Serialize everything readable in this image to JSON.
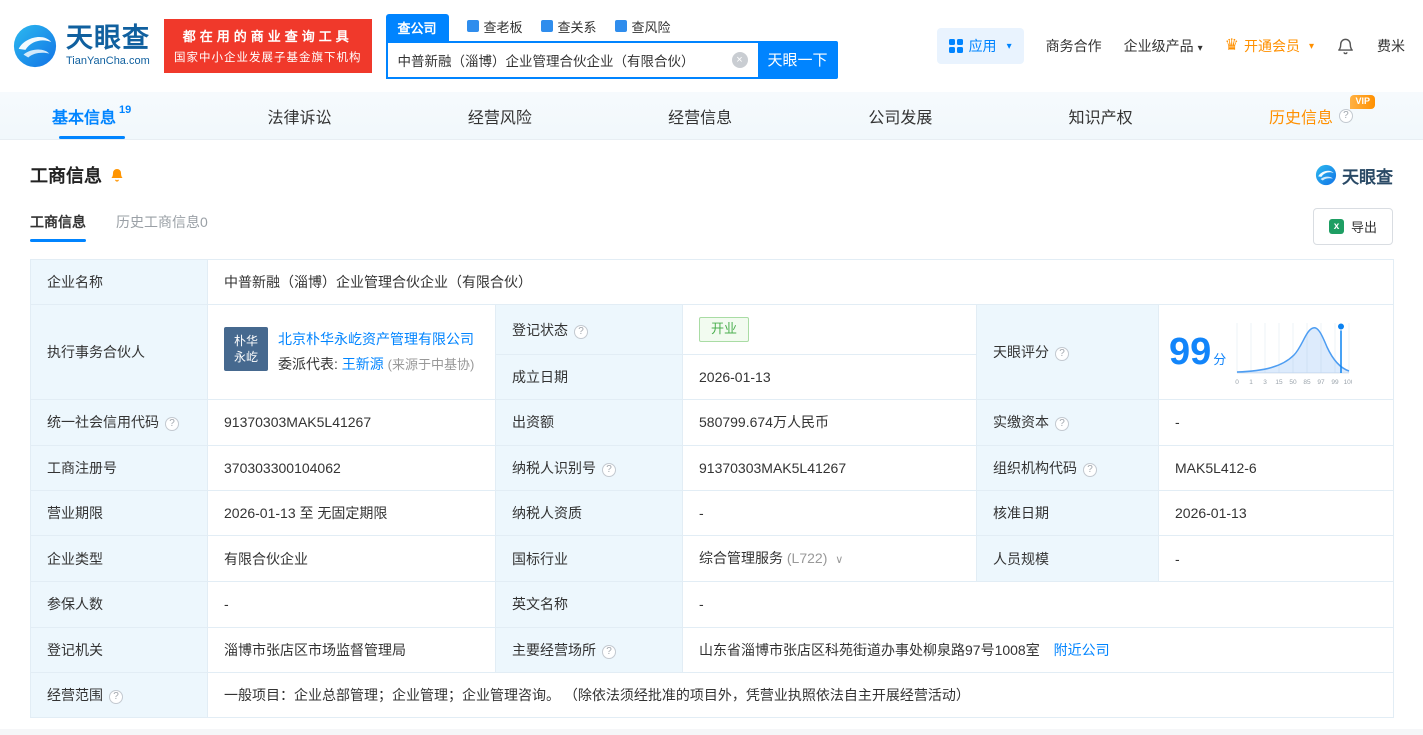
{
  "topbar": {
    "logo": {
      "title": "天眼查",
      "subtitle": "TianYanCha.com"
    },
    "slogan": {
      "line1": "都在用的商业查询工具",
      "line2": "国家中小企业发展子基金旗下机构"
    },
    "search": {
      "tabs": [
        {
          "label": "查公司",
          "active": true
        },
        {
          "label": "查老板"
        },
        {
          "label": "查关系"
        },
        {
          "label": "查风险"
        }
      ],
      "value": "中普新融（淄博）企业管理合伙企业（有限合伙）",
      "button": "天眼一下"
    },
    "right": {
      "apps": "应用",
      "cooperation": "商务合作",
      "enterprise": "企业级产品",
      "vip": "开通会员",
      "user": "费米"
    }
  },
  "nav": {
    "tabs": [
      {
        "label": "基本信息",
        "count": "19",
        "active": true
      },
      {
        "label": "法律诉讼"
      },
      {
        "label": "经营风险"
      },
      {
        "label": "经营信息"
      },
      {
        "label": "公司发展"
      },
      {
        "label": "知识产权"
      },
      {
        "label": "历史信息",
        "vip": "VIP"
      }
    ]
  },
  "section": {
    "title": "工商信息",
    "brand": "天眼查",
    "subtabs": [
      {
        "label": "工商信息",
        "active": true
      },
      {
        "label": "历史工商信息0"
      }
    ],
    "export": "导出"
  },
  "table": {
    "company_name": {
      "label": "企业名称",
      "value": "中普新融（淄博）企业管理合伙企业（有限合伙）"
    },
    "executive_partner": {
      "label": "执行事务合伙人",
      "avatar_line1": "朴华",
      "avatar_line2": "永屹",
      "company": "北京朴华永屹资产管理有限公司",
      "delegate_label": "委派代表: ",
      "delegate": "王新源",
      "source": "(来源于中基协)"
    },
    "reg_status": {
      "label": "登记状态",
      "value": "开业"
    },
    "score": {
      "label": "天眼评分",
      "value": "99",
      "unit": "分",
      "ticks": [
        "0",
        "1",
        "3",
        "15",
        "50",
        "85",
        "97",
        "99",
        "100"
      ]
    },
    "establish_date": {
      "label": "成立日期",
      "value": "2026-01-13"
    },
    "credit_code": {
      "label": "统一社会信用代码",
      "value": "91370303MAK5L41267"
    },
    "capital": {
      "label": "出资额",
      "value": "580799.674万人民币"
    },
    "paid_capital": {
      "label": "实缴资本",
      "value": "-"
    },
    "reg_number": {
      "label": "工商注册号",
      "value": "370303300104062"
    },
    "taxpayer_id": {
      "label": "纳税人识别号",
      "value": "91370303MAK5L41267"
    },
    "org_code": {
      "label": "组织机构代码",
      "value": "MAK5L412-6"
    },
    "business_term": {
      "label": "营业期限",
      "value": "2026-01-13 至 无固定期限"
    },
    "taxpayer_quality": {
      "label": "纳税人资质",
      "value": "-"
    },
    "approval_date": {
      "label": "核准日期",
      "value": "2026-01-13"
    },
    "company_type": {
      "label": "企业类型",
      "value": "有限合伙企业"
    },
    "industry": {
      "label": "国标行业",
      "value": "综合管理服务",
      "code": "(L722)"
    },
    "staff_size": {
      "label": "人员规模",
      "value": "-"
    },
    "insured_count": {
      "label": "参保人数",
      "value": "-"
    },
    "english_name": {
      "label": "英文名称",
      "value": "-"
    },
    "reg_authority": {
      "label": "登记机关",
      "value": "淄博市张店区市场监督管理局"
    },
    "business_address": {
      "label": "主要经营场所",
      "value": "山东省淄博市张店区科苑街道办事处柳泉路97号1008室",
      "nearby": "附近公司"
    },
    "business_scope": {
      "label": "经营范围",
      "value": "一般项目：企业总部管理；企业管理；企业管理咨询。 （除依法须经批准的项目外，凭营业执照依法自主开展经营活动）"
    }
  }
}
